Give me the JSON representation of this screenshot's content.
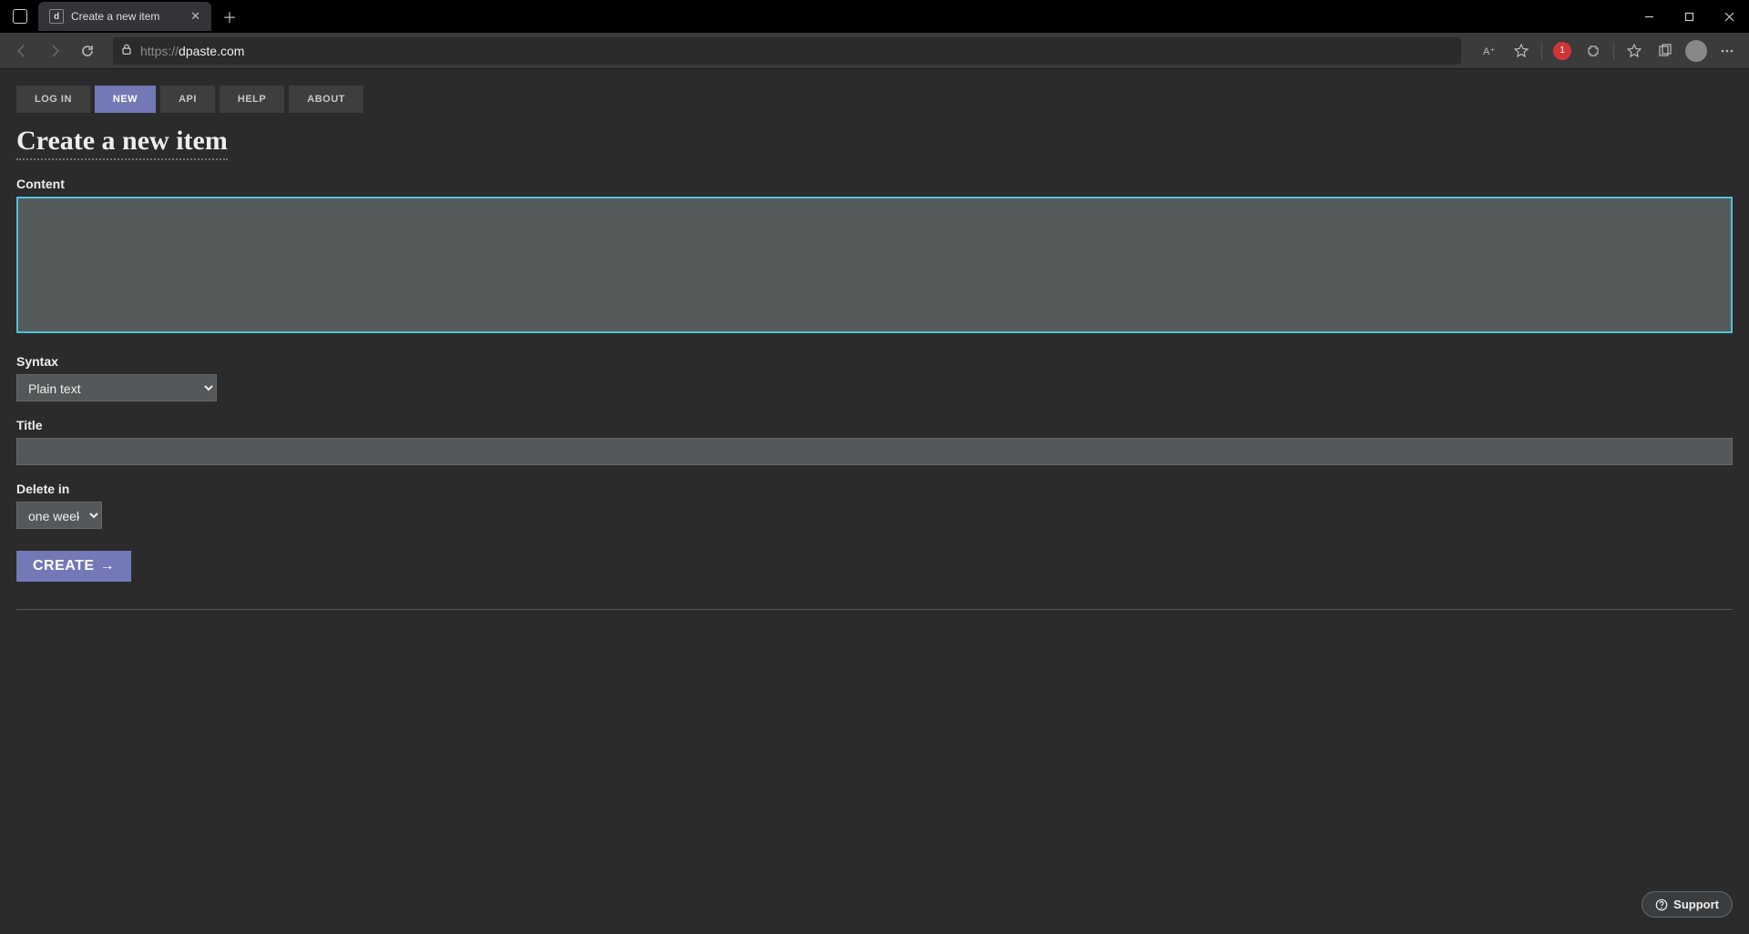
{
  "browser": {
    "tab_title": "Create a new item",
    "tab_favicon_text": "d",
    "url_scheme": "https://",
    "url_host": "dpaste.com",
    "extension_badge": "1"
  },
  "nav": {
    "login": "Log in",
    "new": "New",
    "api": "API",
    "help": "Help",
    "about": "About"
  },
  "page": {
    "title": "Create a new item",
    "label_content": "Content",
    "content_value": "",
    "label_syntax": "Syntax",
    "syntax_selected": "Plain text",
    "label_title": "Title",
    "title_value": "",
    "label_delete_in": "Delete in",
    "delete_in_selected": "one week",
    "create_button": "CREATE"
  },
  "support": {
    "label": "Support"
  }
}
